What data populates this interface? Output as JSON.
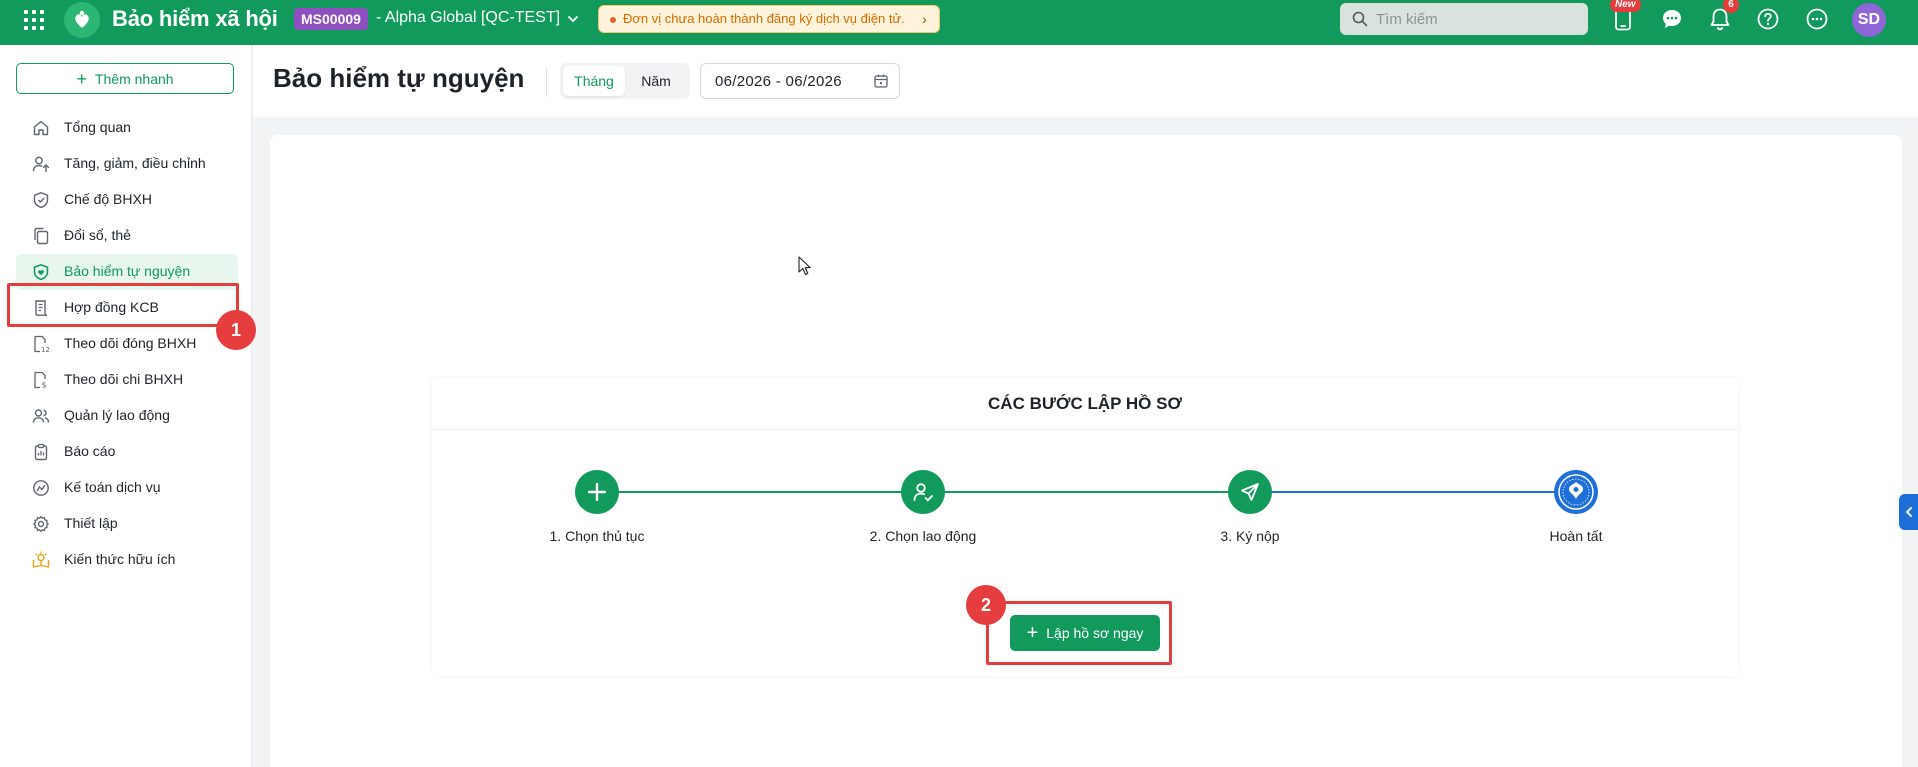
{
  "topbar": {
    "app_title": "Bảo hiểm xã hội",
    "org_code": "MS00009",
    "org_name": "- Alpha Global [QC-TEST]",
    "notice": "Đơn vị chưa hoàn thành đăng ký dịch vụ điện tử.",
    "search_placeholder": "Tìm kiếm",
    "new_badge": "New",
    "notification_count": "6",
    "avatar_initials": "SD"
  },
  "sidebar": {
    "quick_add": "Thêm nhanh",
    "items": [
      {
        "label": "Tổng quan",
        "icon": "home-icon"
      },
      {
        "label": "Tăng, giảm, điều chỉnh",
        "icon": "user-arrow-icon"
      },
      {
        "label": "Chế độ BHXH",
        "icon": "shield-icon"
      },
      {
        "label": "Đổi sổ, thẻ",
        "icon": "copy-icon"
      },
      {
        "label": "Bảo hiểm tự nguyện",
        "icon": "shield-heart-icon",
        "active": true
      },
      {
        "label": "Hợp đồng KCB",
        "icon": "contract-icon"
      },
      {
        "label": "Theo dõi đóng BHXH",
        "icon": "calendar-doc-icon"
      },
      {
        "label": "Theo dõi chi BHXH",
        "icon": "doc-money-icon"
      },
      {
        "label": "Quản lý lao động",
        "icon": "users-icon"
      },
      {
        "label": "Báo cáo",
        "icon": "clipboard-icon"
      },
      {
        "label": "Kế toán dịch vụ",
        "icon": "chart-circle-icon"
      },
      {
        "label": "Thiết lập",
        "icon": "gear-icon"
      },
      {
        "label": "Kiến thức hữu ích",
        "icon": "bulb-book-icon"
      }
    ]
  },
  "header": {
    "title": "Bảo hiểm tự nguyện",
    "period_options": [
      "Tháng",
      "Năm"
    ],
    "period_selected": "Tháng",
    "date_range": "06/2026 - 06/2026"
  },
  "steps": {
    "title": "CÁC BƯỚC LẬP HỒ SƠ",
    "items": [
      {
        "label": "1. Chọn thủ tục",
        "icon": "plus-icon"
      },
      {
        "label": "2. Chọn lao động",
        "icon": "user-check-icon"
      },
      {
        "label": "3. Ký nộp",
        "icon": "send-icon"
      },
      {
        "label": "Hoàn tất",
        "icon": "bhxh-logo-icon"
      }
    ],
    "create_button": "Lập hồ sơ ngay"
  },
  "annotations": {
    "badge_1": "1",
    "badge_2": "2"
  },
  "colors": {
    "brand": "#119a5c",
    "highlight": "#e53d3d",
    "step_done": "#119a5c",
    "step_final": "#1e6fd9"
  }
}
